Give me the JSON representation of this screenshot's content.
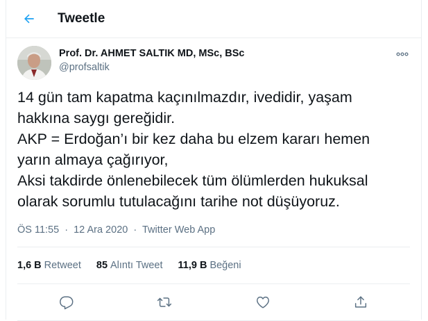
{
  "header": {
    "title": "Tweetle"
  },
  "author": {
    "name": "Prof. Dr. AHMET SALTIK MD, MSc, BSc",
    "handle": "@profsaltik"
  },
  "tweet": {
    "lines": [
      "14 gün tam kapatma kaçınılmazdır, ivedidir, yaşam",
      "hakkına saygı gereğidir.",
      "AKP = Erdoğan’ı bir kez daha bu elzem kararı hemen",
      "yarın almaya çağırıyor,",
      "Aksi takdirde önlenebilecek tüm ölümlerden hukuksal",
      "olarak sorumlu tutulacağını tarihe not düşüyoruz."
    ]
  },
  "meta": {
    "time": "ÖS 11:55",
    "separator": "·",
    "date": "12 Ara 2020",
    "source": "Twitter Web App"
  },
  "stats": [
    {
      "count": "1,6 B",
      "label": "Retweet"
    },
    {
      "count": "85",
      "label": "Alıntı Tweet"
    },
    {
      "count": "11,9 B",
      "label": "Beğeni"
    }
  ],
  "icons": {
    "back": "arrow-left-icon",
    "more": "more-dots-icon",
    "reply": "reply-icon",
    "retweet": "retweet-icon",
    "like": "heart-icon",
    "share": "share-icon"
  },
  "colors": {
    "accent": "#1da1f2",
    "text": "#0f1419",
    "secondary": "#5b7083",
    "border": "#ebeef0"
  }
}
